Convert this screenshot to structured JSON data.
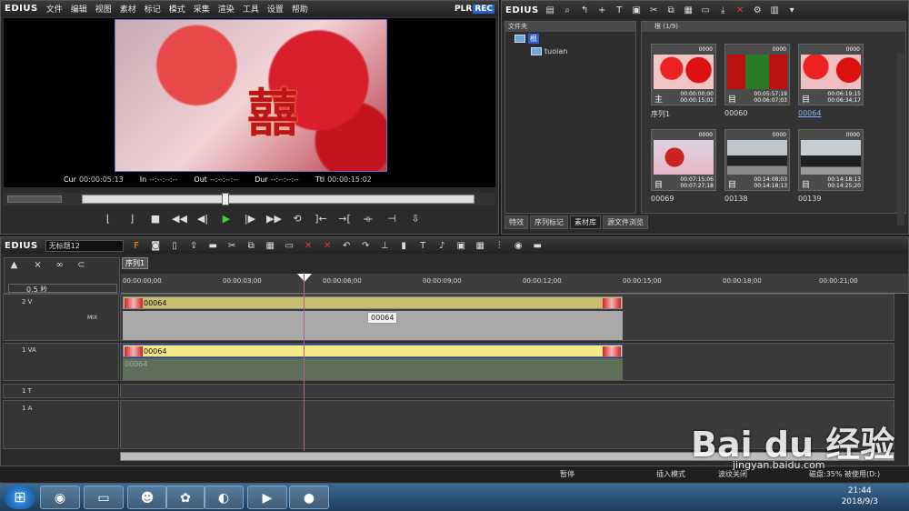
{
  "player": {
    "logo": "EDIUS",
    "menu": [
      "文件",
      "编辑",
      "视图",
      "素材",
      "标记",
      "模式",
      "采集",
      "渲染",
      "工具",
      "设置",
      "帮助"
    ],
    "plr": "PLR",
    "rec": "REC",
    "overlay_char": "囍",
    "timecodes": {
      "cur_label": "Cur",
      "cur": "00:00:05:13",
      "in_label": "In",
      "in": "--:--:--:--",
      "out_label": "Out",
      "out": "--:--:--:--",
      "dur_label": "Dur",
      "dur": "--:--:--:--",
      "ttl_label": "Ttl",
      "ttl": "00:00:15:02"
    }
  },
  "bin": {
    "logo": "EDIUS",
    "folder_header": "文件夹",
    "folder_root": "根",
    "folder_child": "tuoian",
    "clip_header": "根 (1/9)",
    "clips": [
      {
        "name": "序列1",
        "num": "0000",
        "tc1": "00:00:00;00",
        "tc2": "00:00:15;02",
        "badge": "主"
      },
      {
        "name": "00060",
        "num": "0000",
        "tc1": "00:05:57;19",
        "tc2": "00:06:07;03",
        "badge": "目"
      },
      {
        "name": "00064",
        "num": "0000",
        "tc1": "00:06:19;15",
        "tc2": "00:06:34;17",
        "badge": "目"
      },
      {
        "name": "00069",
        "num": "0000",
        "tc1": "00:07:15;06",
        "tc2": "00:07:27;18",
        "badge": "目"
      },
      {
        "name": "00138",
        "num": "0000",
        "tc1": "00:14:08;03",
        "tc2": "00:14:18;13",
        "badge": "目"
      },
      {
        "name": "00139",
        "num": "0000",
        "tc1": "00:14:18;13",
        "tc2": "00:14:25;20",
        "badge": "目"
      }
    ],
    "tabs": [
      "特效",
      "序列标记",
      "素材库",
      "源文件浏览"
    ]
  },
  "timeline": {
    "logo": "EDIUS",
    "project_name": "无标题12",
    "sequence_tab": "序列1",
    "zoom": "0.5 秒",
    "ruler": [
      "00:00:00;00",
      "00:00:03;00",
      "00:00:06;00",
      "00:00:09;00",
      "00:00:12;00",
      "00:00:15;00",
      "00:00:18;00",
      "00:00:21;00"
    ],
    "tracks": {
      "v2": "2 V",
      "v2_mix": "MIX",
      "va1": "1 VA",
      "t1": "1 T",
      "a1": "1 A"
    },
    "clip_v2": "00064",
    "clip_va1": "00064",
    "clip_va1_audio": "00064",
    "tooltip": "00064"
  },
  "status": {
    "pause": "暂停",
    "insert": "插入模式",
    "ripple": "波纹关闭",
    "disk": "磁盘:35% 被使用(D:)"
  },
  "taskbar": {
    "time": "21:44",
    "date": "2018/9/3"
  },
  "watermark": {
    "text": "Bai du 经验",
    "url": "jingyan.baidu.com"
  },
  "colors": {
    "accent_blue": "#2a63c9",
    "clip_yellow": "#d3c473",
    "clip_selected": "#f6ec8b",
    "playhead": "#b45f8f"
  }
}
